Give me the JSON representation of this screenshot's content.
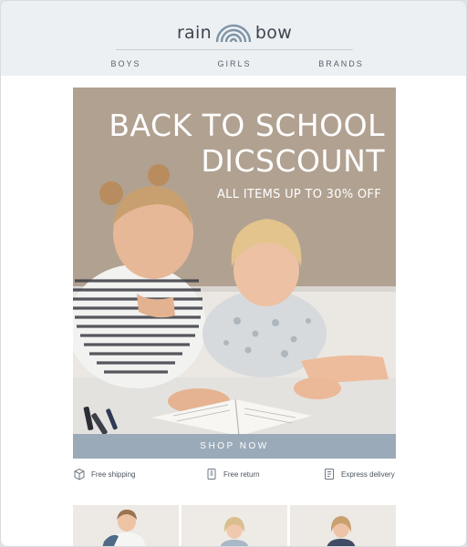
{
  "brand": {
    "word_left": "rain",
    "word_right": "bow",
    "logo_icon": "rainbow-arc-icon"
  },
  "nav": {
    "items": [
      "BOYS",
      "GIRLS",
      "BRANDS"
    ]
  },
  "hero": {
    "title_line1": "BACK TO SCHOOL",
    "title_line2": "DICSCOUNT",
    "subtitle": "ALL ITEMS UP TO 30% OFF",
    "image": "children-reading-book-photo"
  },
  "cta": {
    "label": "SHOP NOW"
  },
  "features": [
    {
      "label": "Free shipping",
      "icon": "box-icon"
    },
    {
      "label": "Free return",
      "icon": "return-tag-icon"
    },
    {
      "label": "Express delivery",
      "icon": "delivery-doc-icon"
    }
  ],
  "products": [
    {
      "image": "boy-product-photo"
    },
    {
      "image": "girl-product-photo"
    },
    {
      "image": "girl-product-photo"
    }
  ],
  "colors": {
    "header_bg": "#edf0f3",
    "cta_bg": "#9aaab8",
    "hero_bg": "#b0a090",
    "text": "#3d4650"
  }
}
